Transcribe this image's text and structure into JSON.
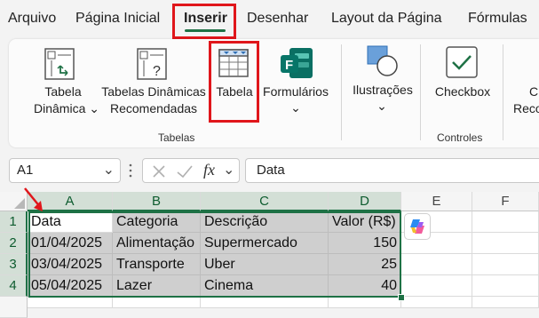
{
  "menu": {
    "tabs": [
      "Arquivo",
      "Página Inicial",
      "Inserir",
      "Desenhar",
      "Layout da Página",
      "Fórmulas"
    ],
    "active_tab": "Inserir"
  },
  "ribbon": {
    "tabela_dinamica": [
      "Tabela",
      "Dinâmica ⌄"
    ],
    "tabelas_dinamicas_recomendadas": [
      "Tabelas Dinâmicas",
      "Recomendadas"
    ],
    "tabela": "Tabela",
    "formularios": "Formulários",
    "ilustracoes": "Ilustrações",
    "checkbox": "Checkbox",
    "cutoff": [
      "C",
      "Reco"
    ],
    "group_tabelas": "Tabelas",
    "group_controles": "Controles",
    "chevron": "⌄"
  },
  "formula_bar": {
    "name_box": "A1",
    "fx": "fx",
    "content": "Data"
  },
  "grid": {
    "columns": [
      "A",
      "B",
      "C",
      "D",
      "E",
      "F"
    ],
    "rows": [
      "1",
      "2",
      "3",
      "4"
    ],
    "cells": [
      [
        "Data",
        "Categoria",
        "Descrição",
        "Valor (R$)"
      ],
      [
        "01/04/2025",
        "Alimentação",
        "Supermercado",
        "150"
      ],
      [
        "03/04/2025",
        "Transporte",
        "Uber",
        "25"
      ],
      [
        "05/04/2025",
        "Lazer",
        "Cinema",
        "40"
      ]
    ]
  },
  "colors": {
    "excel_green": "#1e7145",
    "highlight_red": "#e0161b"
  }
}
